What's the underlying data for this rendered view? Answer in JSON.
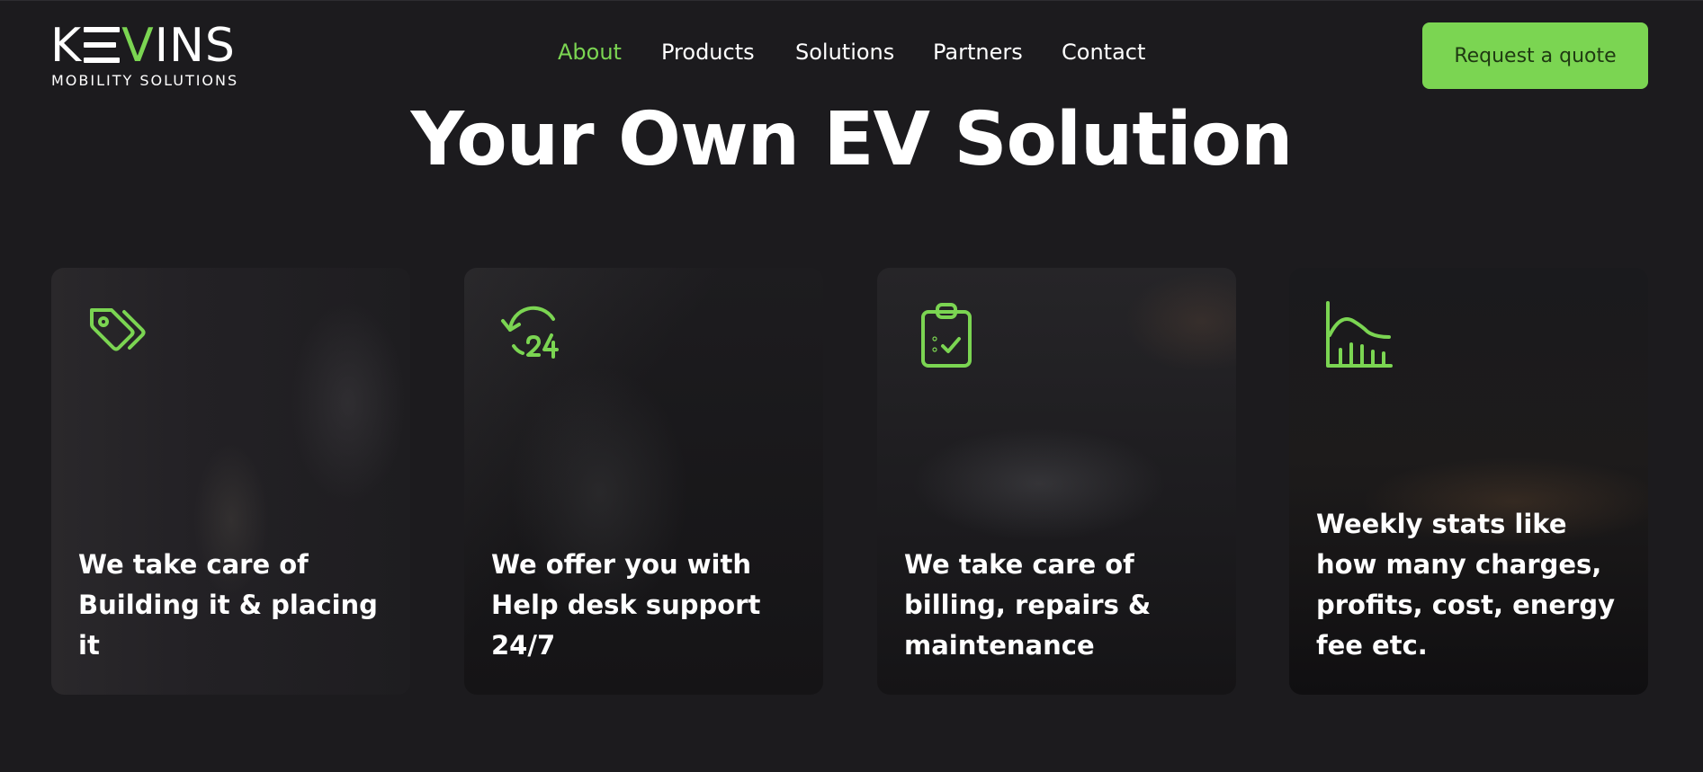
{
  "brand": {
    "logo_start": "K",
    "logo_end": "INS",
    "logo_v": "V",
    "tagline": "MOBILITY SOLUTIONS",
    "accent": "#7bd552"
  },
  "nav": {
    "items": [
      {
        "label": "About",
        "active": true
      },
      {
        "label": "Products",
        "active": false
      },
      {
        "label": "Solutions",
        "active": false
      },
      {
        "label": "Partners",
        "active": false
      },
      {
        "label": "Contact",
        "active": false
      }
    ]
  },
  "header": {
    "cta_label": "Request a quote"
  },
  "hero": {
    "title": "Your Own EV Solution"
  },
  "cards": [
    {
      "icon": "tags-icon",
      "text": "We take care of Building it & placing it"
    },
    {
      "icon": "24-hour-support-icon",
      "text": "We offer you with Help desk support 24/7"
    },
    {
      "icon": "clipboard-check-icon",
      "text": "We take care of billing, repairs & maintenance"
    },
    {
      "icon": "stats-chart-icon",
      "text": "Weekly stats like how many charges, profits, cost, energy fee etc."
    }
  ]
}
